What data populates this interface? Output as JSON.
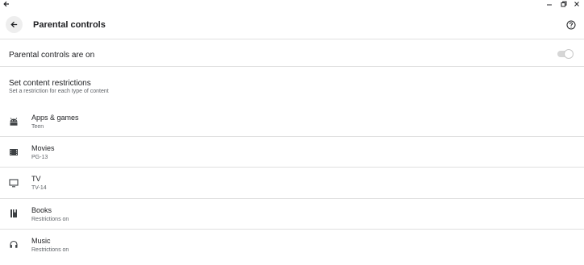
{
  "window": {
    "controls": [
      "back-icon",
      "minimize-icon",
      "restore-icon",
      "close-icon"
    ]
  },
  "header": {
    "title": "Parental controls",
    "back_icon": "arrow-left-icon",
    "help_icon": "help-circle-icon"
  },
  "master_toggle": {
    "label": "Parental controls are on",
    "state": "on"
  },
  "restrictions": {
    "title": "Set content restrictions",
    "subtitle": "Set a restriction for each type of content",
    "items": [
      {
        "icon": "android-icon",
        "title": "Apps & games",
        "value": "Teen"
      },
      {
        "icon": "movie-icon",
        "title": "Movies",
        "value": "PG-13"
      },
      {
        "icon": "tv-icon",
        "title": "TV",
        "value": "TV-14"
      },
      {
        "icon": "book-icon",
        "title": "Books",
        "value": "Restrictions on"
      },
      {
        "icon": "headphones-icon",
        "title": "Music",
        "value": "Restrictions on"
      }
    ]
  },
  "colors": {
    "text_primary": "#202124",
    "text_secondary": "#5f6368",
    "divider": "#e0e0e0",
    "toggle_track": "#d6d6d6"
  }
}
